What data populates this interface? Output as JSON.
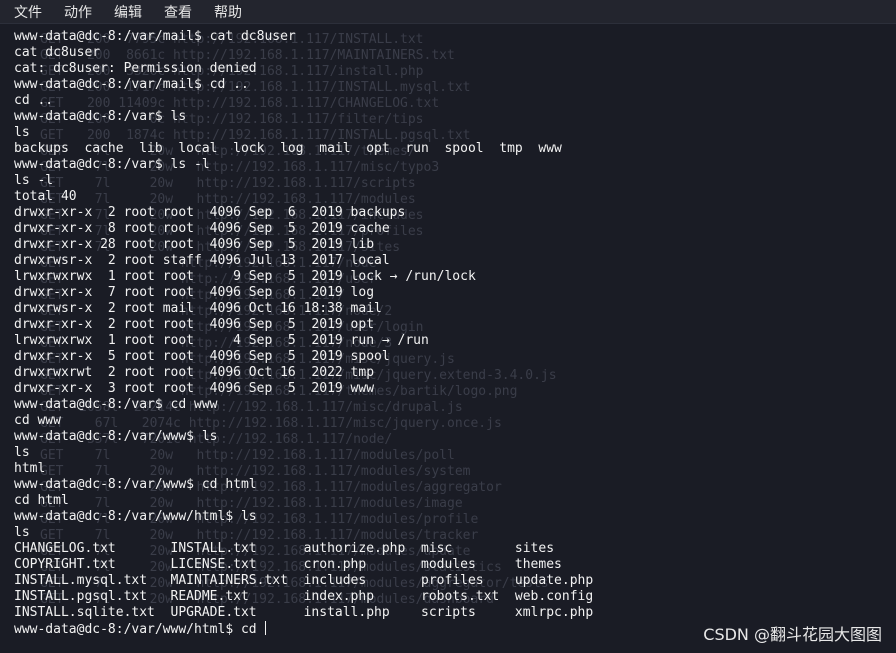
{
  "menubar": {
    "items": [
      "文件",
      "动作",
      "编辑",
      "查看",
      "帮助"
    ]
  },
  "terminal": {
    "lines": [
      "www-data@dc-8:/var/mail$ cat dc8user",
      "cat dc8user",
      "cat: dc8user: Permission denied",
      "www-data@dc-8:/var/mail$ cd ..",
      "cd ..",
      "www-data@dc-8:/var$ ls",
      "ls",
      "backups  cache  lib  local  lock  log  mail  opt  run  spool  tmp  www",
      "www-data@dc-8:/var$ ls -l",
      "ls -l",
      "total 40",
      "drwxr-xr-x  2 root root  4096 Sep  6  2019 backups",
      "drwxr-xr-x  8 root root  4096 Sep  5  2019 cache",
      "drwxr-xr-x 28 root root  4096 Sep  5  2019 lib",
      "drwxrwsr-x  2 root staff 4096 Jul 13  2017 local",
      "lrwxrwxrwx  1 root root     9 Sep  5  2019 lock → /run/lock",
      "drwxr-xr-x  7 root root  4096 Sep  6  2019 log",
      "drwxrwsr-x  2 root mail  4096 Oct 16 18:38 mail",
      "drwxr-xr-x  2 root root  4096 Sep  5  2019 opt",
      "lrwxrwxrwx  1 root root     4 Sep  5  2019 run → /run",
      "drwxr-xr-x  5 root root  4096 Sep  5  2019 spool",
      "drwxrwxrwt  2 root root  4096 Oct 16  2022 tmp",
      "drwxr-xr-x  3 root root  4096 Sep  5  2019 www",
      "www-data@dc-8:/var$ cd www",
      "cd www",
      "www-data@dc-8:/var/www$ ls",
      "ls",
      "html",
      "www-data@dc-8:/var/www$ cd html",
      "cd html",
      "www-data@dc-8:/var/www/html$ ls",
      "ls",
      "CHANGELOG.txt       INSTALL.txt      authorize.php  misc        sites",
      "COPYRIGHT.txt       LICENSE.txt      cron.php       modules     themes",
      "INSTALL.mysql.txt   MAINTAINERS.txt  includes       profiles    update.php",
      "INSTALL.pgsql.txt   README.txt       index.php      robots.txt  web.config",
      "INSTALL.sqlite.txt  UPGRADE.txt      install.php    scripts     xmlrpc.php",
      "www-data@dc-8:/var/www/html$ cd "
    ],
    "background_lines": [
      "",
      "",
      "GET   200  7795c http://192.168.1.117/INSTALL.txt",
      "GET   200  8661c http://192.168.1.117/MAINTAINERS.txt",
      "GET   200  3326c http://192.168.1.117/install.php",
      "GET   200  1717c http://192.168.1.117/INSTALL.mysql.txt",
      "GET   200 11409c http://192.168.1.117/CHANGELOG.txt",
      "GET   200     0c http://192.168.1.117/filter/tips",
      "GET   200  1874c http://192.168.1.117/INSTALL.pgsql.txt",
      "GET    7l     20w   http://192.168.1.117/themes/",
      "GET    7l     20w   http://192.168.1.117/misc/typo3",
      "GET    7l     20w   http://192.168.1.117/scripts",
      "GET    7l     20w   http://192.168.1.117/modules",
      "GET    7l     20w   http://192.168.1.117/includes",
      "GET    7l     20w   http://192.168.1.117/profiles",
      "GET    7l     20w   http://192.168.1.117/sites",
      "GET               http://192.168.1.117/node",
      "GET               http://192.168.1.117/user",
      "GET               http://192.168.1.117/",
      "GET               http://192.168.1.117/node/2",
      "GET               http://192.168.1.117/user/login",
      "GET               http://192.168.1.117/node/3",
      "GET               http://192.168.1.117/misc/jquery.js",
      "GET               http://192.168.1.117/misc/jquery.extend-3.4.0.js",
      "GET               http://192.168.1.117/themes/bartik/logo.png",
      "GET  2058l  28214c http://192.168.1.117/misc/drupal.js",
      "GET    67l   2074c http://192.168.1.117/misc/jquery.once.js",
      "GET   357l   7201c http://192.168.1.117/node/",
      "GET    7l     20w   http://192.168.1.117/modules/poll",
      "GET    7l     20w   http://192.168.1.117/modules/system",
      "GET    7l     20w   http://192.168.1.117/modules/aggregator",
      "GET    7l     20w   http://192.168.1.117/modules/image",
      "GET    7l     20w   http://192.168.1.117/modules/profile",
      "GET    7l     20w   http://192.168.1.117/modules/tracker",
      "GET    7l     20w   http://192.168.1.117/modules/update",
      "GET    7l     20w   http://192.168.1.117/modules/statistics",
      "GET    7l     20w   http://192.168.1.117/modules/aggregator/tests",
      "GET    7l     20w   http://192.168.1.117/modules/dashboard"
    ]
  },
  "watermark": "CSDN @翻斗花园大图图"
}
